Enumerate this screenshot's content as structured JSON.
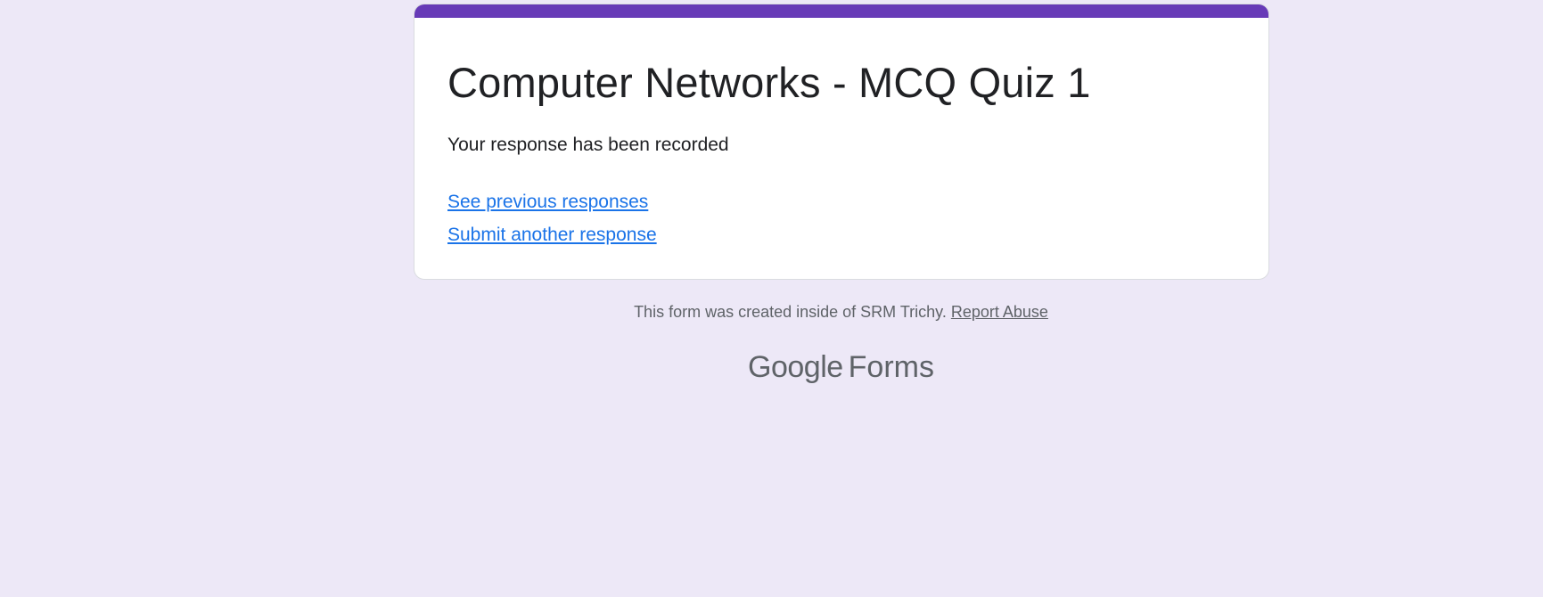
{
  "form": {
    "title": "Computer Networks - MCQ Quiz 1",
    "confirmation": "Your response has been recorded",
    "links": {
      "previous": "See previous responses",
      "another": "Submit another response"
    }
  },
  "footer": {
    "note": "This form was created inside of SRM Trichy.",
    "report_abuse": "Report Abuse",
    "brand_google": "Google",
    "brand_product": "Forms"
  },
  "colors": {
    "background": "#ede8f7",
    "accent": "#673ab7",
    "link": "#1a73e8",
    "muted_text": "#5f6368"
  }
}
